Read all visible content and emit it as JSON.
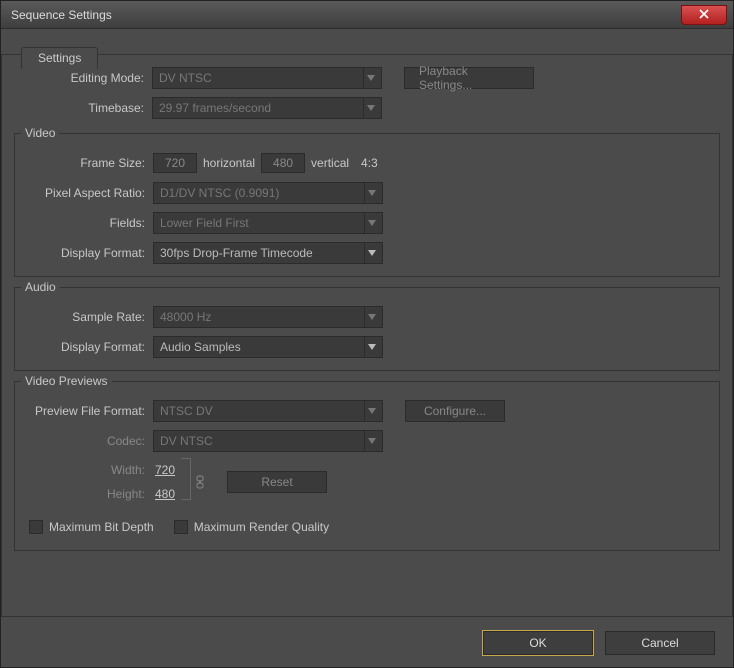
{
  "window": {
    "title": "Sequence Settings"
  },
  "tab": {
    "label": "Settings"
  },
  "editingMode": {
    "label": "Editing Mode:",
    "value": "DV NTSC",
    "playback": "Playback Settings..."
  },
  "timebase": {
    "label": "Timebase:",
    "value": "29.97 frames/second"
  },
  "video": {
    "legend": "Video",
    "frameSize": {
      "label": "Frame Size:",
      "w": "720",
      "h": "480",
      "horiz": "horizontal",
      "vert": "vertical",
      "aspect": "4:3"
    },
    "par": {
      "label": "Pixel Aspect Ratio:",
      "value": "D1/DV NTSC (0.9091)"
    },
    "fields": {
      "label": "Fields:",
      "value": "Lower Field First"
    },
    "displayFormat": {
      "label": "Display Format:",
      "value": "30fps Drop-Frame Timecode"
    }
  },
  "audio": {
    "legend": "Audio",
    "sampleRate": {
      "label": "Sample Rate:",
      "value": "48000 Hz"
    },
    "displayFormat": {
      "label": "Display Format:",
      "value": "Audio Samples"
    }
  },
  "previews": {
    "legend": "Video Previews",
    "fileFormat": {
      "label": "Preview File Format:",
      "value": "NTSC DV",
      "configure": "Configure..."
    },
    "codec": {
      "label": "Codec:",
      "value": "DV NTSC"
    },
    "width": {
      "label": "Width:",
      "value": "720"
    },
    "height": {
      "label": "Height:",
      "value": "480"
    },
    "reset": "Reset",
    "maxBitDepth": "Maximum Bit Depth",
    "maxRenderQuality": "Maximum Render Quality"
  },
  "buttons": {
    "ok": "OK",
    "cancel": "Cancel"
  }
}
